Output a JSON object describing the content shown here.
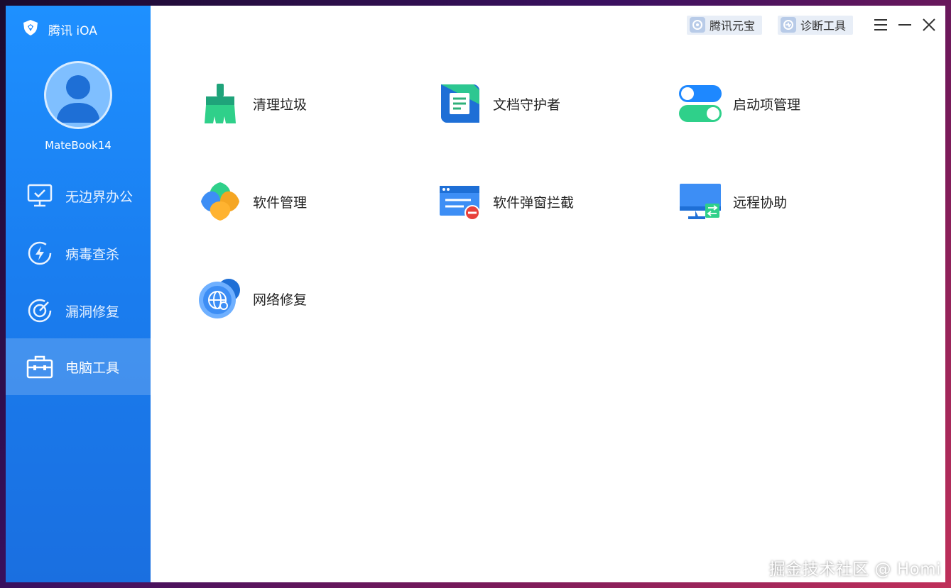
{
  "app": {
    "brand": "腾讯 iOA",
    "device_name": "MateBook14"
  },
  "sidebar": {
    "items": [
      {
        "label": "无边界办公",
        "icon": "monitor-icon"
      },
      {
        "label": "病毒查杀",
        "icon": "lightning-shield-icon"
      },
      {
        "label": "漏洞修复",
        "icon": "target-icon"
      },
      {
        "label": "电脑工具",
        "icon": "toolbox-icon",
        "active": true
      }
    ]
  },
  "topbar": {
    "yuanbao_label": "腾讯元宝",
    "diagnose_label": "诊断工具"
  },
  "tools": [
    {
      "label": "清理垃圾",
      "icon": "broom-icon"
    },
    {
      "label": "文档守护者",
      "icon": "document-icon"
    },
    {
      "label": "启动项管理",
      "icon": "toggle-switch-icon"
    },
    {
      "label": "软件管理",
      "icon": "clover-icon"
    },
    {
      "label": "软件弹窗拦截",
      "icon": "popup-block-icon"
    },
    {
      "label": "远程协助",
      "icon": "remote-monitor-icon"
    },
    {
      "label": "网络修复",
      "icon": "globe-repair-icon"
    }
  ],
  "watermark": "掘金技术社区 @ Homi",
  "colors": {
    "sidebar": "#1a7ef0",
    "active_item": "#4b9bf5",
    "accent_green": "#2fd08a",
    "accent_blue": "#1e88ff"
  }
}
